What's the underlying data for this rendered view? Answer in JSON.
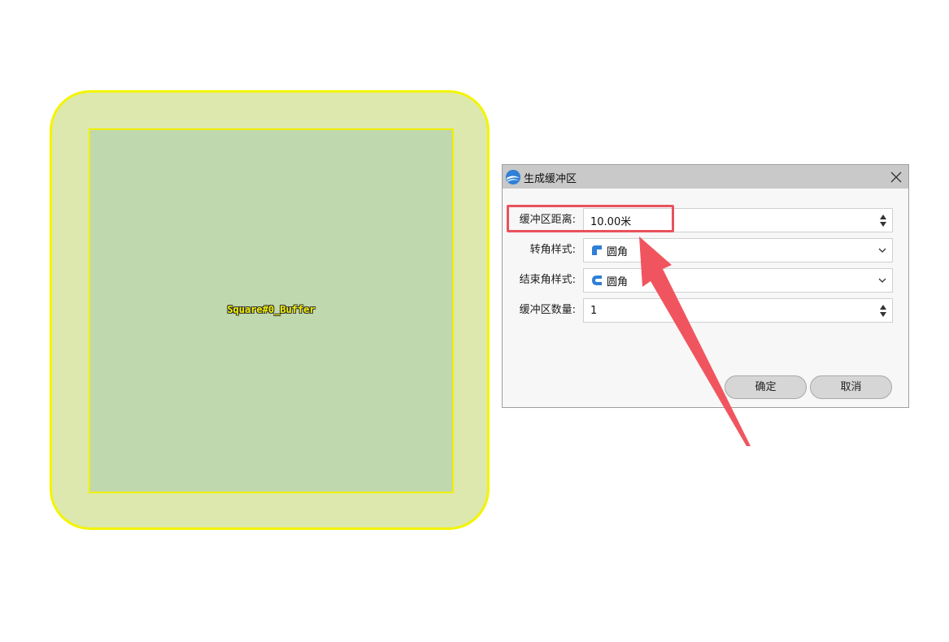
{
  "map": {
    "feature_label": "Square#0_Buffer"
  },
  "dialog": {
    "title": "生成缓冲区",
    "fields": [
      {
        "label": "缓冲区距离:",
        "value": "10.00米",
        "control": "spinbox"
      },
      {
        "label": "转角样式:",
        "value": "圆角",
        "control": "dropdown",
        "icon": "round-corner-icon"
      },
      {
        "label": "结束角样式:",
        "value": "圆角",
        "control": "dropdown",
        "icon": "round-end-icon"
      },
      {
        "label": "缓冲区数量:",
        "value": "1",
        "control": "spinbox"
      }
    ],
    "ok_label": "确定",
    "cancel_label": "取消"
  },
  "colors": {
    "buffer_fill": "#dce8ad",
    "square_fill": "#c0d8ad",
    "outline": "#f4f400",
    "annotation": "#e9525c",
    "accent_blue": "#2f7fd6"
  }
}
